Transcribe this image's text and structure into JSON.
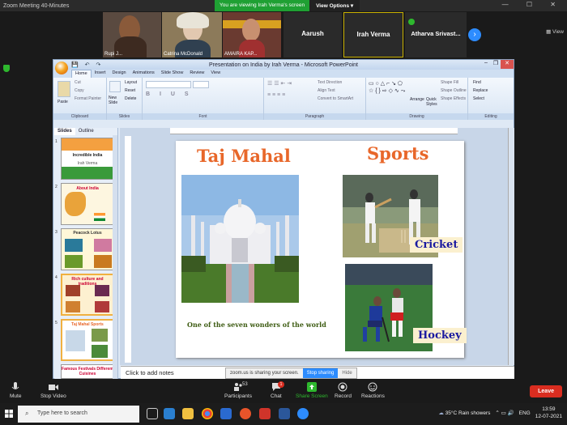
{
  "zoom": {
    "window_title": "Zoom Meeting 40-Minutes",
    "share_banner": "You are viewing Irah Verma's screen",
    "view_options": "View Options",
    "view_label": "View",
    "participants": [
      {
        "name": "Rupi J..."
      },
      {
        "name": "Catrina McDonald"
      },
      {
        "name": "AMAIRA KAP..."
      },
      {
        "name": "Aarush"
      },
      {
        "name": "Irah Verma"
      },
      {
        "name": "Atharva  Srivast..."
      }
    ]
  },
  "ppt": {
    "title": "Presentation on India by Irah Verma - Microsoft PowerPoint",
    "tabs": [
      "Home",
      "Insert",
      "Design",
      "Animations",
      "Slide Show",
      "Review",
      "View"
    ],
    "active_tab": "Home",
    "groups": [
      "Clipboard",
      "Slides",
      "Font",
      "Paragraph",
      "Drawing",
      "Editing"
    ],
    "clipboard": {
      "paste": "Paste",
      "cut": "Cut",
      "copy": "Copy",
      "format_painter": "Format Painter"
    },
    "slides_group": {
      "new_slide": "New Slide",
      "layout": "Layout",
      "reset": "Reset",
      "delete": "Delete"
    },
    "paragraph": {
      "text_direction": "Text Direction",
      "align_text": "Align Text",
      "convert_smartart": "Convert to SmartArt"
    },
    "drawing": {
      "arrange": "Arrange",
      "quick_styles": "Quick Styles",
      "shape_fill": "Shape Fill",
      "shape_outline": "Shape Outline",
      "shape_effects": "Shape Effects"
    },
    "editing": {
      "find": "Find",
      "replace": "Replace",
      "select": "Select"
    },
    "panel_tabs": [
      "Slides",
      "Outline"
    ],
    "thumbnails": [
      {
        "num": "1",
        "title": "Incredible India",
        "sub": "Irah Verma"
      },
      {
        "num": "2",
        "title": "About India"
      },
      {
        "num": "3",
        "title": "Peacock  Lotus"
      },
      {
        "num": "4",
        "title": "Rich culture and traditions"
      },
      {
        "num": "5",
        "title": "Taj Mahal   Sports"
      },
      {
        "num": "6",
        "title": "Famous Festivals   Different Cuisines"
      }
    ],
    "slide": {
      "left_heading": "Taj Mahal",
      "right_heading": "Sports",
      "caption": "One of the seven wonders of the world",
      "label_cricket": "Cricket",
      "label_hockey": "Hockey"
    },
    "notes_placeholder": "Click to add notes"
  },
  "share_notice": {
    "message": "zoom.us is sharing your screen.",
    "stop": "Stop sharing",
    "hide": "Hide"
  },
  "toolbar": {
    "mute": "Mute",
    "stop_video": "Stop Video",
    "participants": "Participants",
    "participant_count": "53",
    "chat": "Chat",
    "chat_badge": "1",
    "share_screen": "Share Screen",
    "record": "Record",
    "reactions": "Reactions",
    "leave": "Leave"
  },
  "taskbar": {
    "search_placeholder": "Type here to search",
    "weather": "35°C  Rain showers",
    "lang": "ENG",
    "time": "13:59",
    "date": "12-07-2021"
  },
  "colors": {
    "heading_orange": "#e8672a",
    "label_blue": "#1a1aa0",
    "zoom_blue": "#2d8cff",
    "leave_red": "#d92d20",
    "share_green": "#1fa033"
  }
}
